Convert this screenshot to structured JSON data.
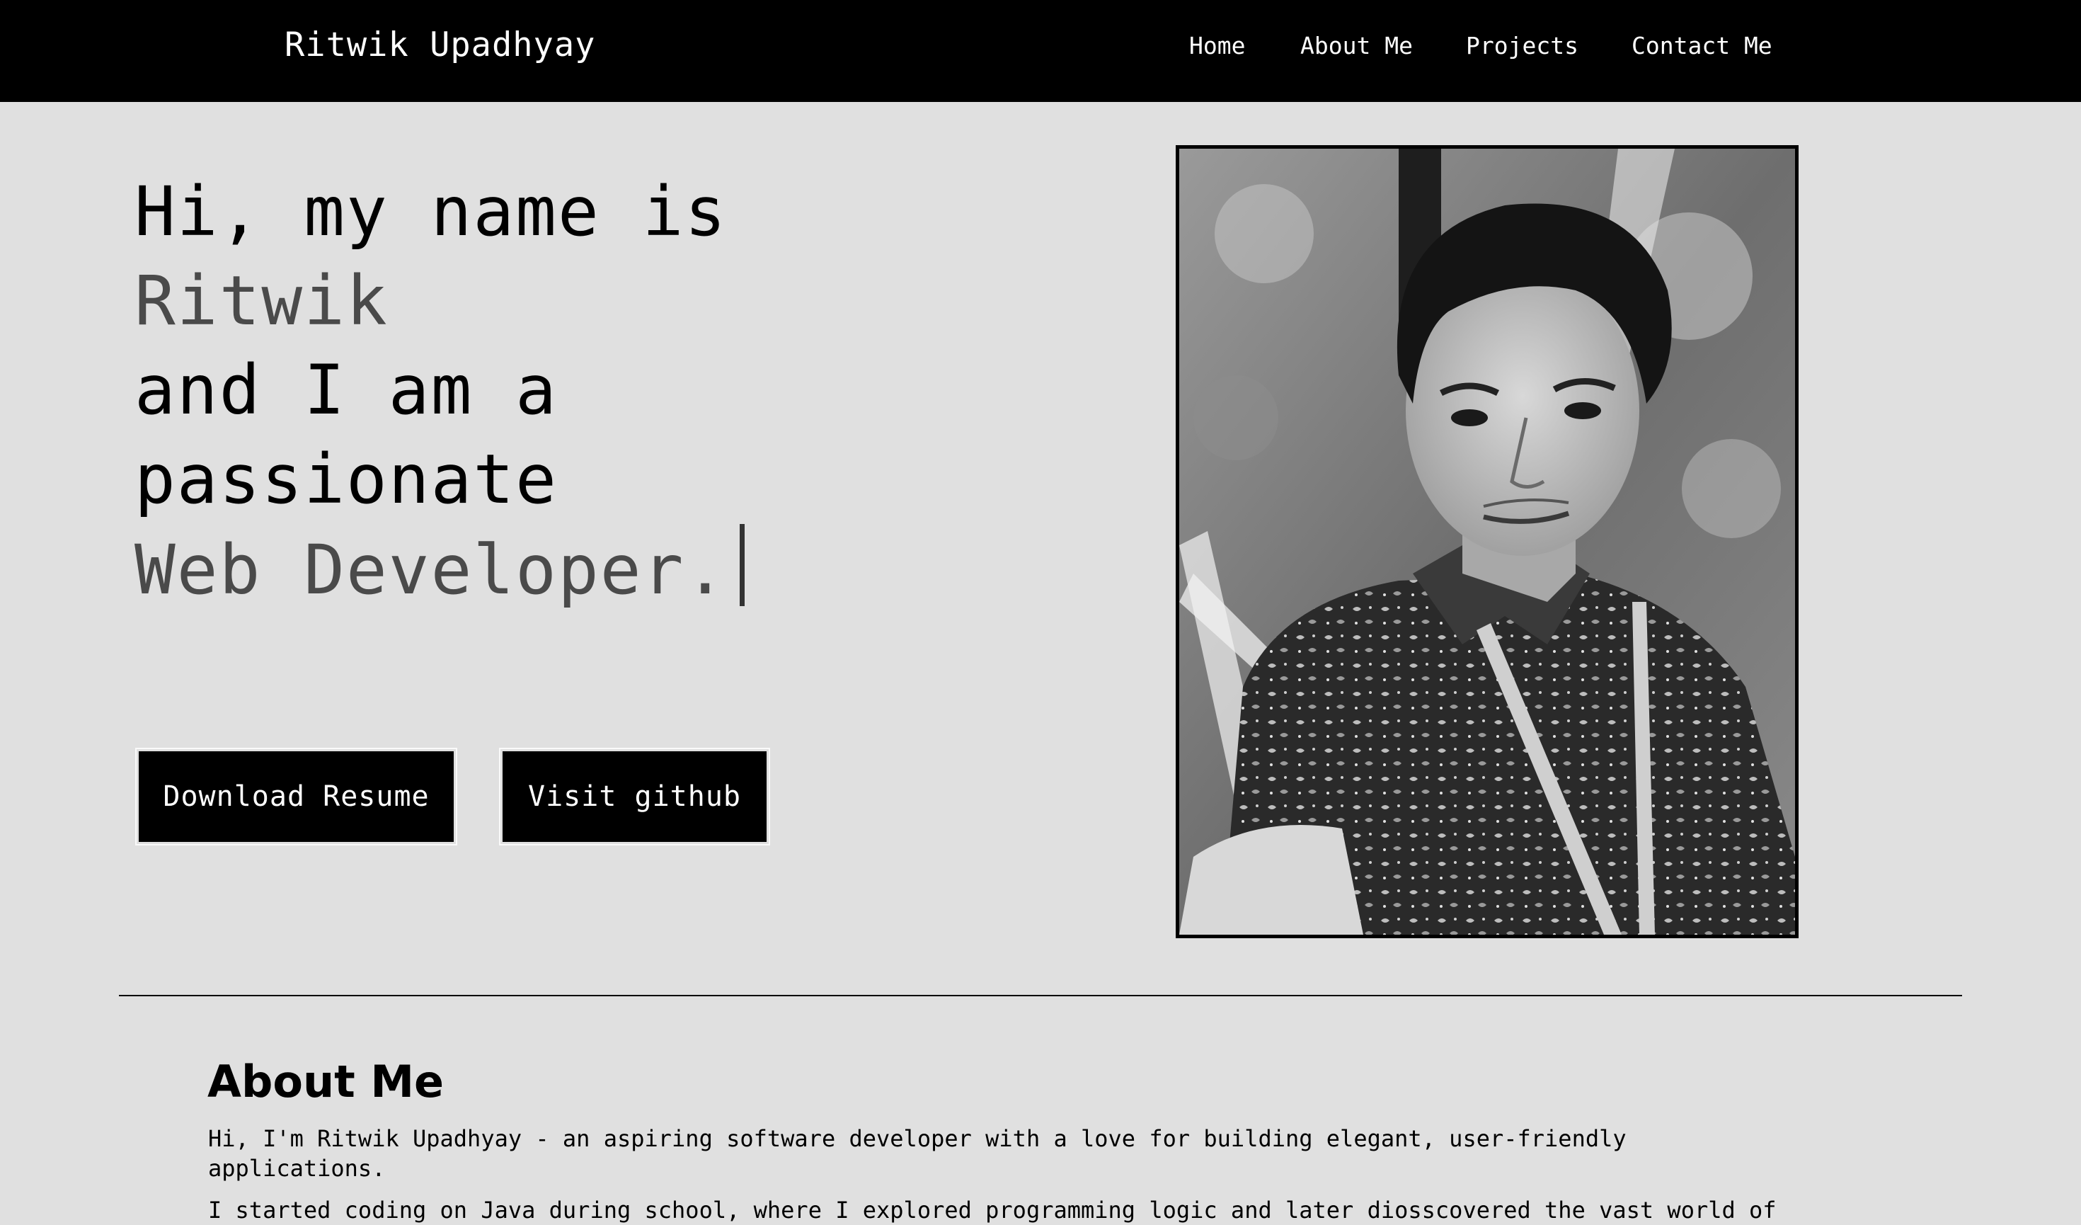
{
  "navbar": {
    "brand": "Ritwik Upadhyay",
    "links": [
      {
        "label": "Home"
      },
      {
        "label": "About Me"
      },
      {
        "label": "Projects"
      },
      {
        "label": "Contact Me"
      }
    ]
  },
  "hero": {
    "line1": "Hi, my name is",
    "name": "Ritwik",
    "line3": "and I am a",
    "line4": "passionate",
    "role": "Web Developer.",
    "buttons": {
      "resume": "Download Resume",
      "github": "Visit github"
    },
    "photo_icon": "portrait-photo"
  },
  "about": {
    "title": "About Me",
    "paragraphs": [
      "Hi, I'm Ritwik Upadhyay - an aspiring software developer with a love for building elegant, user-friendly applications.",
      "I started coding on Java during school, where I explored programming logic and later diosscovered the vast world of"
    ]
  },
  "colors": {
    "navbar_bg": "#000000",
    "page_bg": "#e0e0e0",
    "accent_text": "#4a4a4a",
    "button_bg": "#000000"
  }
}
